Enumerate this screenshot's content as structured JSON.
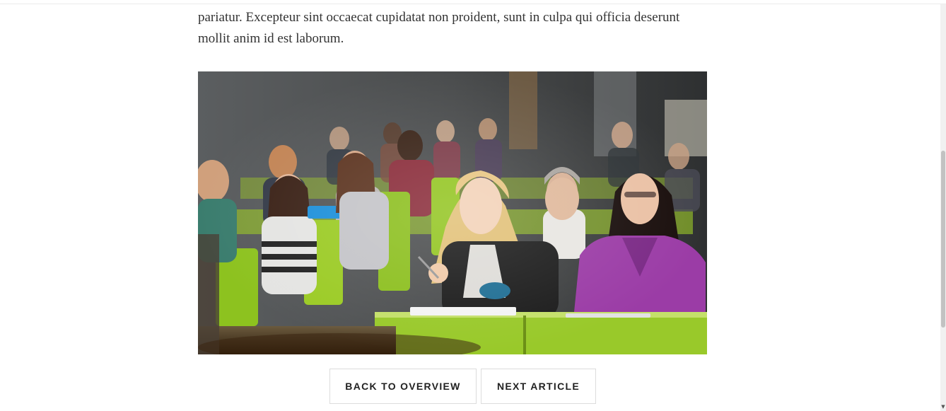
{
  "article": {
    "paragraph": "Duis aute irure dolor in reprehenderit in voluptate velit esse cillum dolore eu fugiat nulla pariatur. Excepteur sint occaecat cupidatat non proident, sunt in culpa qui officia deserunt mollit anim id est laborum."
  },
  "hero_image": {
    "alt": "Students sitting in a lecture hall with green seats, listening attentively"
  },
  "actions": {
    "back_label": "BACK TO OVERVIEW",
    "next_label": "NEXT ARTICLE"
  },
  "scrollbar": {
    "arrow": "▼"
  }
}
